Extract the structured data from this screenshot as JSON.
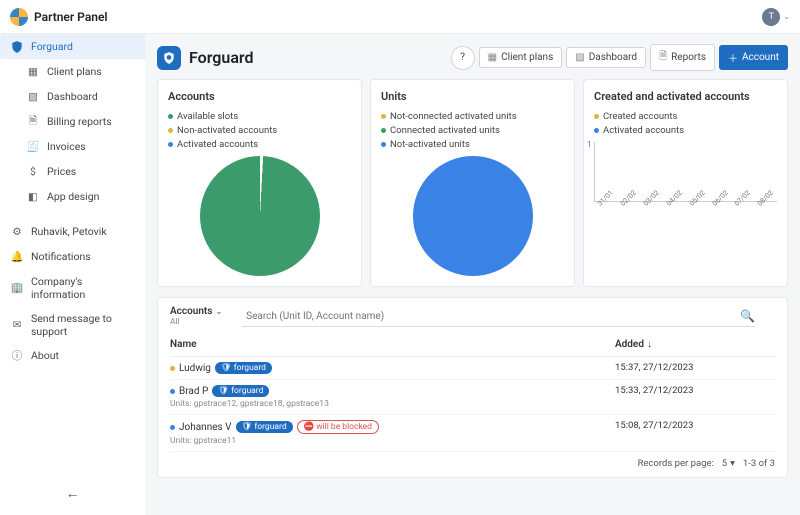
{
  "topbar": {
    "title": "Partner Panel",
    "avatar_initial": "T"
  },
  "sidebar": {
    "items": [
      {
        "label": "Forguard",
        "icon": "shield"
      },
      {
        "label": "Client plans",
        "icon": "grid"
      },
      {
        "label": "Dashboard",
        "icon": "dashboard"
      },
      {
        "label": "Billing reports",
        "icon": "doc"
      },
      {
        "label": "Invoices",
        "icon": "invoice"
      },
      {
        "label": "Prices",
        "icon": "dollar"
      },
      {
        "label": "App design",
        "icon": "design"
      }
    ],
    "secondary": [
      {
        "label": "Ruhavik, Petovik",
        "icon": "gear"
      },
      {
        "label": "Notifications",
        "icon": "bell"
      },
      {
        "label": "Company's information",
        "icon": "building"
      },
      {
        "label": "Send message to support",
        "icon": "send"
      },
      {
        "label": "About",
        "icon": "info"
      }
    ]
  },
  "header": {
    "title": "Forguard",
    "buttons": {
      "client_plans": "Client plans",
      "dashboard": "Dashboard",
      "reports": "Reports",
      "account": "Account"
    }
  },
  "cards": {
    "accounts": {
      "title": "Accounts",
      "legend": [
        "Available slots",
        "Non-activated accounts",
        "Activated accounts"
      ]
    },
    "units": {
      "title": "Units",
      "legend": [
        "Not-connected activated units",
        "Connected activated units",
        "Not-activated units"
      ]
    },
    "created": {
      "title": "Created and activated accounts",
      "legend": [
        "Created accounts",
        "Activated accounts"
      ],
      "y_tick": "1",
      "x_ticks": [
        "31/01",
        "02/02",
        "03/02",
        "04/02",
        "05/02",
        "06/02",
        "07/02",
        "08/02"
      ]
    }
  },
  "chart_data": [
    {
      "type": "pie",
      "title": "Accounts",
      "series": [
        {
          "name": "Available slots",
          "color": "#3b9b6a",
          "value": 99
        },
        {
          "name": "Non-activated accounts",
          "color": "#e0b33a",
          "value": 0
        },
        {
          "name": "Activated accounts",
          "color": "#3b82e6",
          "value": 1
        }
      ]
    },
    {
      "type": "pie",
      "title": "Units",
      "series": [
        {
          "name": "Not-connected activated units",
          "color": "#e0b33a",
          "value": 0
        },
        {
          "name": "Connected activated units",
          "color": "#3b9b6a",
          "value": 0
        },
        {
          "name": "Not-activated units",
          "color": "#3b82e6",
          "value": 100
        }
      ]
    },
    {
      "type": "line",
      "title": "Created and activated accounts",
      "x": [
        "31/01",
        "02/02",
        "03/02",
        "04/02",
        "05/02",
        "06/02",
        "07/02",
        "08/02"
      ],
      "ylim": [
        0,
        1
      ],
      "series": [
        {
          "name": "Created accounts",
          "color": "#e0b33a",
          "values": [
            0,
            0,
            0,
            0,
            0,
            0,
            0,
            0
          ]
        },
        {
          "name": "Activated accounts",
          "color": "#3b82e6",
          "values": [
            0,
            0,
            0,
            0,
            0,
            0,
            0,
            0
          ]
        }
      ]
    }
  ],
  "table": {
    "section_label": "Accounts",
    "section_sub": "All",
    "search_placeholder": "Search (Unit ID, Account name)",
    "col_name": "Name",
    "col_added": "Added",
    "rows": [
      {
        "status": "yellow",
        "name": "Ludwig",
        "tag": "forguard",
        "units": "",
        "blocked": false,
        "added": "15:37, 27/12/2023"
      },
      {
        "status": "blue",
        "name": "Brad P",
        "tag": "forguard",
        "units": "Units: gpstrace12, gpstrace18, gpstrace13",
        "blocked": false,
        "added": "15:33, 27/12/2023"
      },
      {
        "status": "blue",
        "name": "Johannes V",
        "tag": "forguard",
        "units": "Units: gpstrace11",
        "blocked": true,
        "blocked_label": "will be blocked",
        "added": "15:08, 27/12/2023"
      }
    ],
    "pager": {
      "per_page_label": "Records per page:",
      "per_page": "5",
      "range": "1-3 of 3"
    }
  }
}
